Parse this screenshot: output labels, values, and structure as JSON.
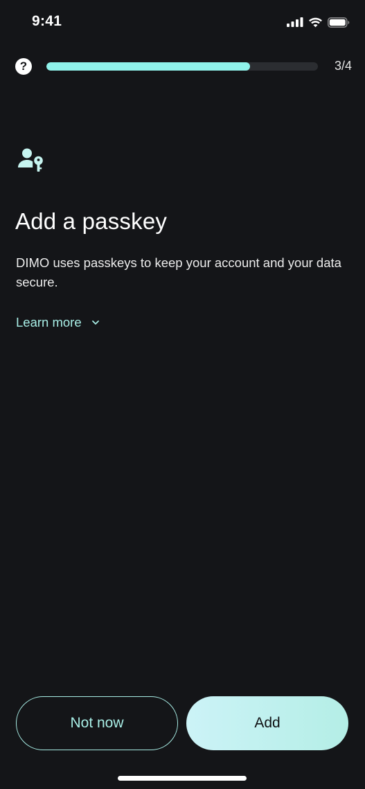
{
  "status_bar": {
    "time": "9:41",
    "icons": [
      "cellular-signal-icon",
      "wifi-icon",
      "battery-icon"
    ]
  },
  "topbar": {
    "help_icon": "question-icon",
    "progress_fraction": 0.75,
    "step_counter": "3/4"
  },
  "main": {
    "icon": "user-key-icon",
    "title": "Add a passkey",
    "description": "DIMO uses passkeys to keep your account and your data secure.",
    "learn_more_label": "Learn more",
    "learn_more_icon": "chevron-down-icon"
  },
  "actions": {
    "secondary_label": "Not now",
    "primary_label": "Add"
  },
  "colors": {
    "background": "#141518",
    "accent": "#8ff2ea",
    "accent_text": "#a8eee6",
    "primary_button": "#c2f1ef"
  }
}
